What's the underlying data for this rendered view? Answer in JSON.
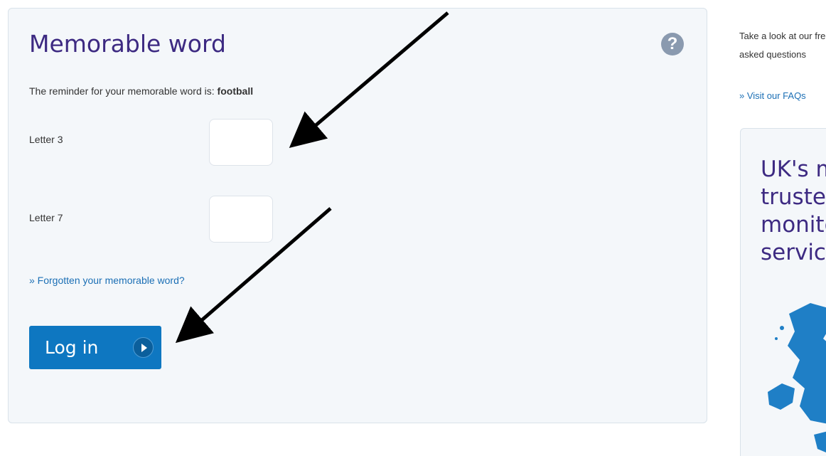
{
  "memorable_word": {
    "title": "Memorable word",
    "reminder_prefix": "The reminder for your memorable word is: ",
    "reminder_word": "football",
    "letter_fields": [
      {
        "label": "Letter 3",
        "value": ""
      },
      {
        "label": "Letter 7",
        "value": ""
      }
    ],
    "forgot_link": "» Forgotten your memorable word?",
    "login_label": "Log in",
    "help_icon": "?"
  },
  "sidebar": {
    "faq_text": "Take a look at our frequently asked questions",
    "faq_link": "» Visit our FAQs",
    "promo_title": "UK's most trusted monitoring service"
  },
  "colors": {
    "title": "#3d2a82",
    "link": "#1b6fb5",
    "button": "#0e77c1",
    "panel_bg": "#f4f7fa"
  },
  "icons": {
    "help": "question-mark-circle-icon",
    "login": "play-arrow-icon",
    "map": "uk-map-icon"
  }
}
